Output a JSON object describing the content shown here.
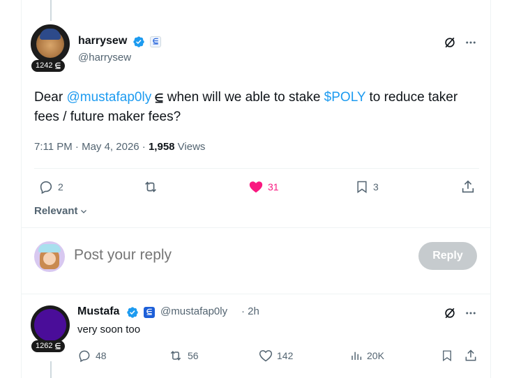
{
  "main_tweet": {
    "author_name": "harrysew",
    "author_handle": "@harrysew",
    "score": "1242",
    "text_before": "Dear ",
    "mention": "@mustafap0ly",
    "text_middle": " when will we able to stake ",
    "cashtag": "$POLY",
    "text_after": " to reduce taker fees / future maker fees?",
    "time": "7:11 PM · May 4, 2026 · ",
    "views_count": "1,958",
    "views_label": " Views",
    "actions": {
      "replies": "2",
      "reposts": "",
      "likes": "31",
      "bookmarks": "3"
    }
  },
  "sort": {
    "label": "Relevant"
  },
  "composer": {
    "placeholder": "Post your reply",
    "button_label": "Reply"
  },
  "reply_tweet": {
    "author_name": "Mustafa",
    "author_handle": "@mustafap0ly",
    "age": "· 2h",
    "score": "1262",
    "text": "very soon too",
    "actions": {
      "replies": "48",
      "reposts": "56",
      "likes": "142",
      "views": "20K"
    }
  },
  "colors": {
    "accent": "#1d9bf0",
    "like_active": "#f91880",
    "muted": "#536471",
    "reply_button_disabled": "#c6cbce"
  }
}
